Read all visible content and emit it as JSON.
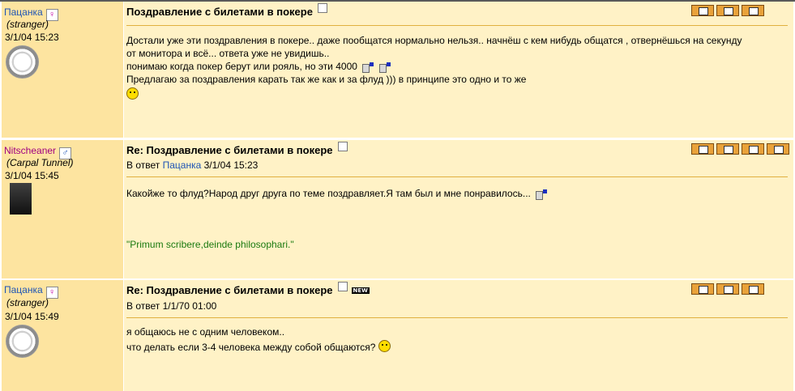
{
  "posts": [
    {
      "username": "Пацанка",
      "gender_symbol": "♀",
      "status": "(stranger)",
      "time": "3/1/04 15:23",
      "title": "Поздравление с билетами в покере",
      "reply_prefix": "",
      "reply_user": "",
      "reply_time": "",
      "lines": [
        "Достали уже эти поздравления в покере.. даже пообщатся нормально нельзя.. начнёш с кем нибудь общатся , отвернёшься на секунду",
        "от монитора и всё... ответа уже не увидишь..",
        "понимаю когда покер берут или рояль, но эти 4000",
        "Предлагаю за поздравления карать так же как и за флуд ))) в принципе это одно и то же"
      ],
      "signature": ""
    },
    {
      "username": "Nitscheaner",
      "gender_symbol": "♂",
      "status": "(Carpal Tunnel)",
      "time": "3/1/04 15:45",
      "title": "Re: Поздравление с билетами в покере",
      "reply_prefix": "В ответ",
      "reply_user": "Пацанка",
      "reply_time": "3/1/04 15:23",
      "lines": [
        "Какойже то флуд?Народ друг друга по теме поздравляет.Я там был и мне понравилось..."
      ],
      "signature": "\"Primum scribere,deinde philosophari.\""
    },
    {
      "username": "Пацанка",
      "gender_symbol": "♀",
      "status": "(stranger)",
      "time": "3/1/04 15:49",
      "title": "Re: Поздравление с билетами в покере",
      "new_badge": "NEW",
      "reply_prefix": "В ответ",
      "reply_user": "",
      "reply_time": "1/1/70 01:00",
      "lines": [
        "я общаюсь не с одним человеком..",
        "что делать если 3-4 человека между собой общаются?"
      ],
      "signature": ""
    }
  ],
  "icons": {
    "tool_1": "reply-icon",
    "tool_2": "print-icon",
    "tool_3": "quote-icon",
    "tool_4": "edit-icon"
  }
}
